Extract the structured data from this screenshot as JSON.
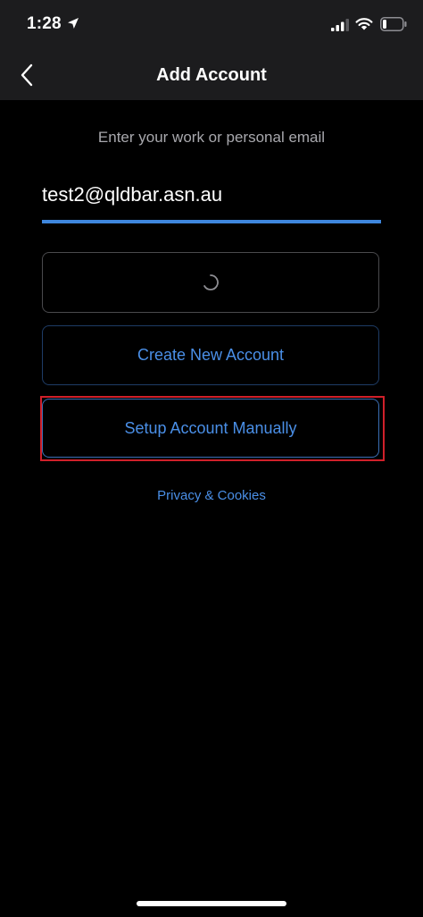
{
  "status_bar": {
    "time": "1:28",
    "icons": [
      "location-arrow-icon",
      "cellular-signal-icon",
      "wifi-icon",
      "battery-icon"
    ]
  },
  "nav": {
    "back_icon": "chevron-left-icon",
    "title": "Add Account"
  },
  "form": {
    "prompt": "Enter your work or personal email",
    "email_value": "test2@qldbar.asn.au"
  },
  "buttons": {
    "continue_state": "loading",
    "create_label": "Create New Account",
    "manual_label": "Setup Account Manually"
  },
  "links": {
    "privacy_label": "Privacy & Cookies"
  },
  "colors": {
    "background": "#000000",
    "bar_background": "#1c1c1e",
    "accent": "#3e86dd",
    "link": "#4a8fe7",
    "highlight": "#d0202a"
  }
}
